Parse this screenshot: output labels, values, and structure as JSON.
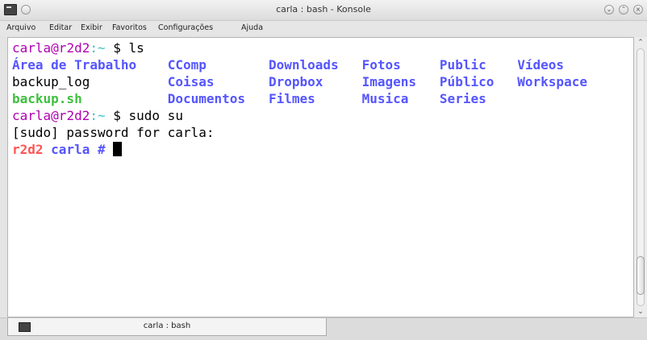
{
  "window": {
    "title": "carla : bash - Konsole",
    "app_icon": "terminal-icon",
    "controls": [
      {
        "name": "minimize-button",
        "glyph": "⌄"
      },
      {
        "name": "maximize-button",
        "glyph": "⌃"
      },
      {
        "name": "close-button",
        "glyph": "×"
      }
    ]
  },
  "menu": [
    "Arquivo",
    "Editar",
    "Exibir",
    "Favoritos",
    "Configurações",
    "Ajuda"
  ],
  "colors": {
    "dir": "#5555ff",
    "exec": "#3ec03e",
    "root_host": "#ff5454",
    "text": "#000000",
    "prompt_sep": "#3ec0c0",
    "prompt_user": "#b000b0"
  },
  "terminal": {
    "lines": [
      [
        {
          "t": "carla",
          "c": "prompt_user"
        },
        {
          "t": "@r2d2",
          "c": "prompt_user"
        },
        {
          "t": ":",
          "c": "prompt_sep"
        },
        {
          "t": "~",
          "c": "prompt_sep"
        },
        {
          "t": " $ ",
          "c": "text"
        },
        {
          "t": "ls",
          "c": "text"
        }
      ],
      [
        {
          "t": "Área de Trabalho",
          "c": "dir",
          "b": true,
          "col": 0
        },
        {
          "t": "CComp",
          "c": "dir",
          "b": true,
          "col": 1
        },
        {
          "t": "Downloads",
          "c": "dir",
          "b": true,
          "col": 2
        },
        {
          "t": "Fotos",
          "c": "dir",
          "b": true,
          "col": 3
        },
        {
          "t": "Public",
          "c": "dir",
          "b": true,
          "col": 4
        },
        {
          "t": "Vídeos",
          "c": "dir",
          "b": true,
          "col": 5
        }
      ],
      [
        {
          "t": "backup_log",
          "c": "text",
          "col": 0
        },
        {
          "t": "Coisas",
          "c": "dir",
          "b": true,
          "col": 1
        },
        {
          "t": "Dropbox",
          "c": "dir",
          "b": true,
          "col": 2
        },
        {
          "t": "Imagens",
          "c": "dir",
          "b": true,
          "col": 3
        },
        {
          "t": "Público",
          "c": "dir",
          "b": true,
          "col": 4
        },
        {
          "t": "Workspace",
          "c": "dir",
          "b": true,
          "col": 5
        }
      ],
      [
        {
          "t": "backup.sh",
          "c": "exec",
          "b": true,
          "col": 0
        },
        {
          "t": "Documentos",
          "c": "dir",
          "b": true,
          "col": 1
        },
        {
          "t": "Filmes",
          "c": "dir",
          "b": true,
          "col": 2
        },
        {
          "t": "Musica",
          "c": "dir",
          "b": true,
          "col": 3
        },
        {
          "t": "Series",
          "c": "dir",
          "b": true,
          "col": 4
        }
      ],
      [
        {
          "t": "carla",
          "c": "prompt_user"
        },
        {
          "t": "@r2d2",
          "c": "prompt_user"
        },
        {
          "t": ":",
          "c": "prompt_sep"
        },
        {
          "t": "~",
          "c": "prompt_sep"
        },
        {
          "t": " $ ",
          "c": "text"
        },
        {
          "t": "sudo su",
          "c": "text"
        }
      ],
      [
        {
          "t": "[sudo] password for carla:",
          "c": "text"
        }
      ],
      [
        {
          "t": "r2d2",
          "c": "root_host",
          "b": true
        },
        {
          "t": " carla # ",
          "c": "dir",
          "b": true
        }
      ]
    ]
  },
  "tab": {
    "label": "carla : bash",
    "icon": "terminal-icon"
  },
  "scrollbar": {
    "up": "⌃",
    "down": "⌄"
  }
}
